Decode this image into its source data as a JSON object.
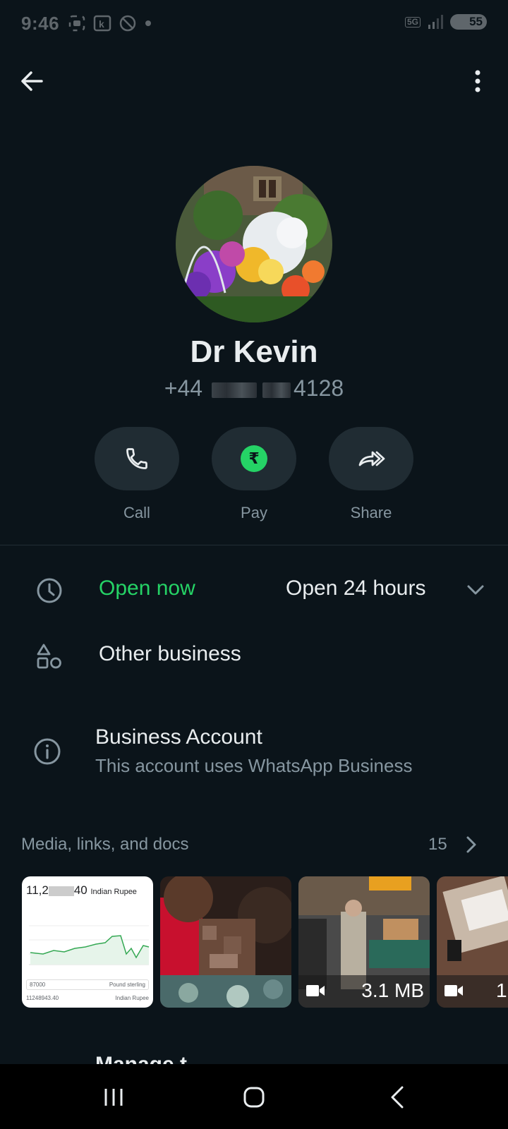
{
  "status_bar": {
    "time": "9:46",
    "network": "5G",
    "battery": "55"
  },
  "profile": {
    "name": "Dr Kevin",
    "phone_prefix": "+44",
    "phone_suffix": "4128"
  },
  "actions": [
    {
      "label": "Call",
      "icon": "phone-icon"
    },
    {
      "label": "Pay",
      "icon": "rupee-icon"
    },
    {
      "label": "Share",
      "icon": "share-icon"
    }
  ],
  "hours": {
    "status": "Open now",
    "detail": "Open 24 hours"
  },
  "category": {
    "label": "Other business"
  },
  "business_account": {
    "title": "Business Account",
    "subtitle": "This account uses WhatsApp Business"
  },
  "media": {
    "header": "Media, links, and docs",
    "count": "15",
    "items": [
      {
        "kind": "image",
        "chart_heading": "11,2",
        "chart_heading_tail": "40",
        "chart_currency": "Indian Rupee",
        "chart_bottom_value": "11248943.40",
        "chart_bottom_unit": "Indian Rupee",
        "chart_mid_value": "87000",
        "chart_mid_unit": "Pound sterling"
      },
      {
        "kind": "image"
      },
      {
        "kind": "video",
        "size": "3.1 MB"
      },
      {
        "kind": "video",
        "size": "1"
      }
    ]
  },
  "peek": {
    "text": "Manage t"
  },
  "colors": {
    "accent": "#25d366",
    "background": "#0b141a",
    "surface": "#202c33",
    "muted": "#8696a0"
  }
}
